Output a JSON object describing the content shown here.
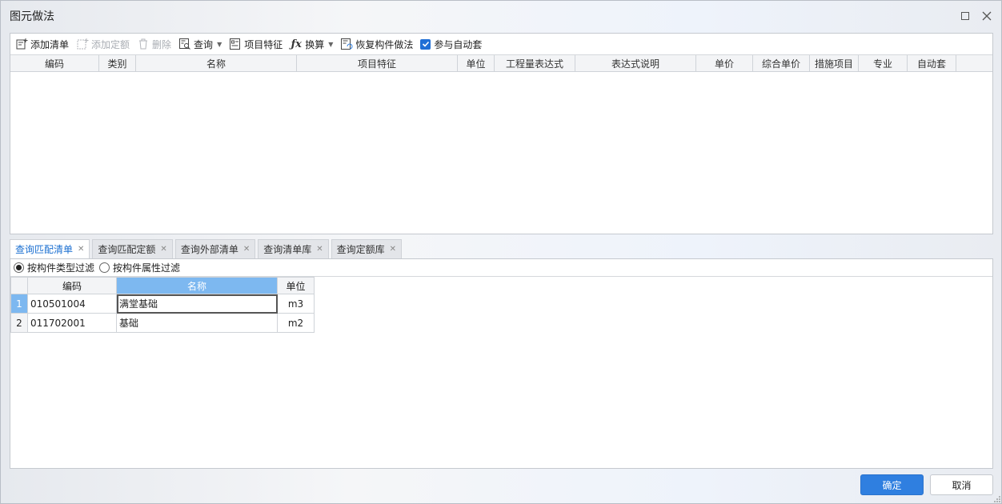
{
  "window": {
    "title": "图元做法"
  },
  "toolbar": {
    "add_list": "添加清单",
    "add_quota": "添加定额",
    "delete": "删除",
    "query": "查询",
    "item_feature": "项目特征",
    "convert": "换算",
    "restore": "恢复构件做法",
    "auto_apply": "参与自动套"
  },
  "top_grid": {
    "columns": [
      "编码",
      "类别",
      "名称",
      "项目特征",
      "单位",
      "工程量表达式",
      "表达式说明",
      "单价",
      "综合单价",
      "措施项目",
      "专业",
      "自动套"
    ]
  },
  "tabs": [
    "查询匹配清单",
    "查询匹配定额",
    "查询外部清单",
    "查询清单库",
    "查询定额库"
  ],
  "filters": {
    "by_type": "按构件类型过滤",
    "by_attr": "按构件属性过滤"
  },
  "list": {
    "columns": [
      "编码",
      "名称",
      "单位"
    ],
    "rows": [
      {
        "num": "1",
        "code": "010501004",
        "name": "满堂基础",
        "unit": "m3"
      },
      {
        "num": "2",
        "code": "011702001",
        "name": "基础",
        "unit": "m2"
      }
    ]
  },
  "buttons": {
    "ok": "确定",
    "cancel": "取消"
  },
  "colors": {
    "accent": "#2f7fe0",
    "selection": "#7db8f0",
    "active_tab": "#1a6fd1"
  }
}
